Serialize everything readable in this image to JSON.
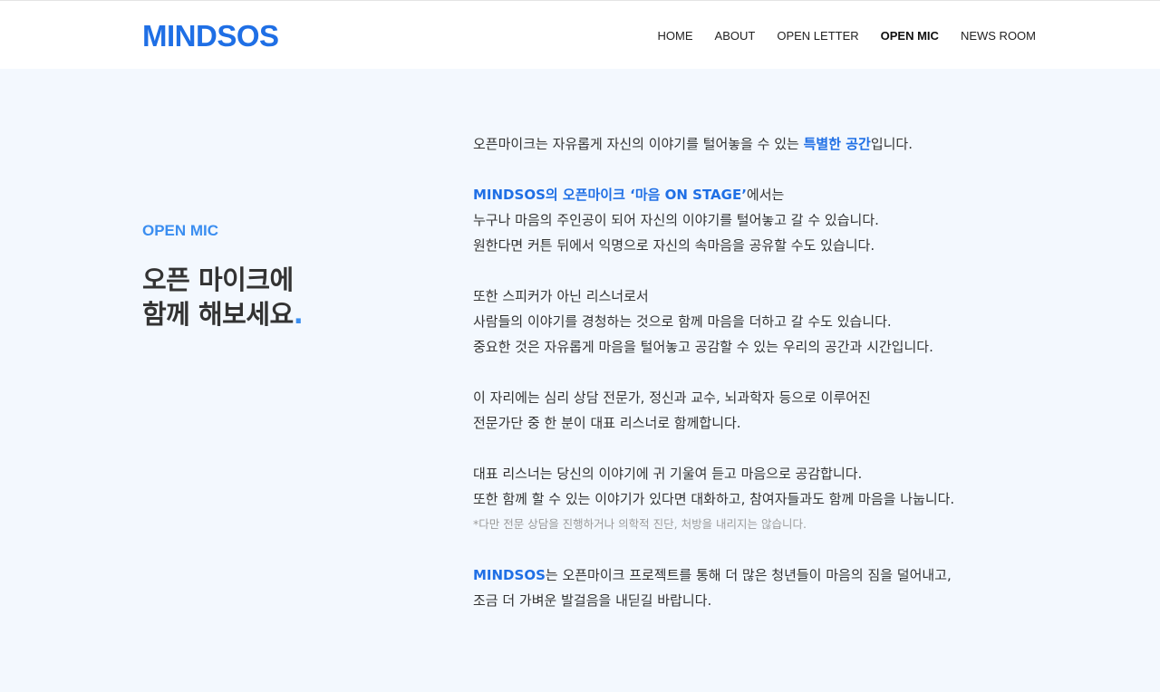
{
  "header": {
    "logo": "MINDSOS",
    "nav": [
      "HOME",
      "ABOUT",
      "OPEN LETTER",
      "OPEN MIC",
      "NEWS ROOM"
    ],
    "active_nav": "OPEN MIC"
  },
  "intro": {
    "label": "OPEN MIC",
    "headline_line1": "오픈 마이크에",
    "headline_line2": "함께 해보세요",
    "headline_dot": "."
  },
  "content": {
    "p1_pre": "오픈마이크는 자유롭게 자신의 이야기를 털어놓을 수 있는 ",
    "p1_hl": "특별한 공간",
    "p1_post": "입니다.",
    "p2_hl": "MINDSOS의 오픈마이크 ‘마음 ON STAGE’",
    "p2_post": "에서는",
    "p2_l2": "누구나 마음의 주인공이 되어 자신의 이야기를 털어놓고 갈 수 있습니다.",
    "p2_l3": "원한다면 커튼 뒤에서 익명으로 자신의 속마음을 공유할 수도 있습니다.",
    "p3_l1": "또한 스피커가 아닌 리스너로서",
    "p3_l2": "사람들의 이야기를 경청하는 것으로 함께 마음을 더하고 갈 수도 있습니다.",
    "p3_l3": "중요한 것은 자유롭게 마음을 털어놓고 공감할 수 있는 우리의 공간과 시간입니다.",
    "p4_l1": "이 자리에는 심리 상담 전문가, 정신과 교수, 뇌과학자 등으로 이루어진",
    "p4_l2": "전문가단 중 한 분이 대표 리스너로 함께합니다.",
    "p5_l1": "대표 리스너는 당신의 이야기에 귀 기울여 듣고 마음으로 공감합니다.",
    "p5_l2": "또한 함께 할 수 있는 이야기가 있다면 대화하고, 참여자들과도 함께 마음을 나눕니다.",
    "p5_note": "*다만 전문 상담을 진행하거나 의학적 진단, 처방을 내리지는 않습니다.",
    "p6_hl": "MINDSOS",
    "p6_post": "는 오픈마이크 프로젝트를 통해 더 많은 청년들이 마음의 짐을 덜어내고,",
    "p6_l2": "조금 더 가벼운 발걸음을 내딛길 바랍니다."
  },
  "colors": {
    "brand": "#1f6fe5",
    "accent": "#3b8ef0",
    "background": "#f3f8fe"
  }
}
